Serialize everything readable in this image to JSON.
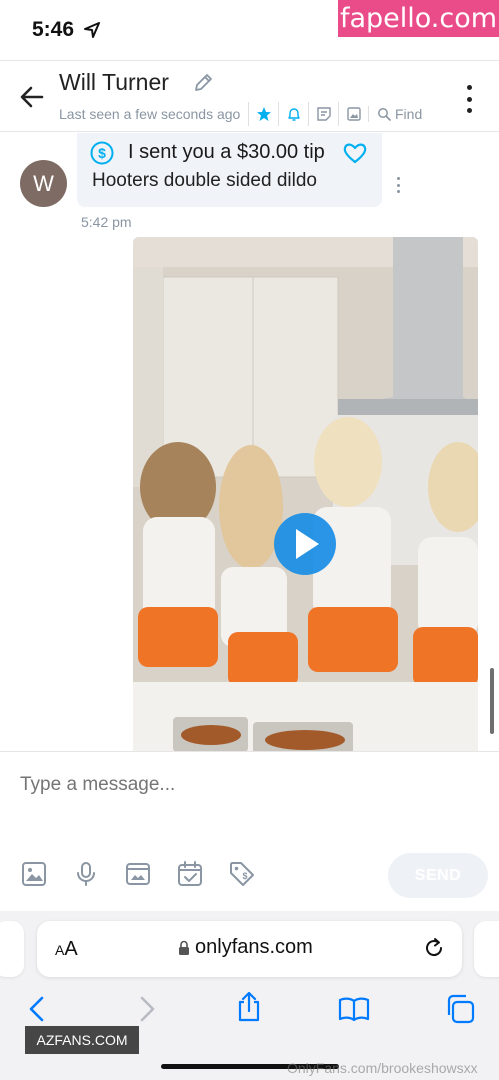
{
  "status_bar": {
    "time": "5:46"
  },
  "watermark_top": "fapello.com",
  "header": {
    "name": "Will Turner",
    "last_seen": "Last seen a few seconds ago",
    "find_label": "Find"
  },
  "message": {
    "avatar_initial": "W",
    "tip_text": "I sent you a $30.00 tip",
    "body": "Hooters double sided dildo",
    "time": "5:42 pm"
  },
  "composer": {
    "placeholder": "Type a message...",
    "send_label": "SEND"
  },
  "browser": {
    "text_size_label_big": "A",
    "text_size_label_small": "A",
    "url": "onlyfans.com"
  },
  "watermarks": {
    "azfans": "AZFANS.COM",
    "onlyfans": "OnlyFans.com/brookeshowsxx"
  },
  "colors": {
    "accent": "#00aff0",
    "muted": "#8a96a3",
    "ios_blue": "#007aff",
    "badge_pink": "#ea4c89"
  }
}
